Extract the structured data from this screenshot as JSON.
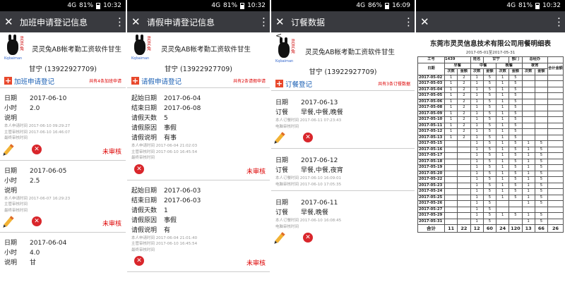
{
  "panels": [
    {
      "status": {
        "signal": "4G",
        "battery": "81%",
        "time": "10:32"
      },
      "title": "加班申请登记信息",
      "app_title": "灵灵兔AB帐考勤工资软件甘生",
      "user": "甘宁 (13922927709)",
      "add_label": "加班申请登记",
      "count": "共有4条加班申请",
      "records": [
        {
          "fields": [
            {
              "k": "日期",
              "v": "2017-06-10"
            },
            {
              "k": "小时",
              "v": "2.0"
            },
            {
              "k": "说明",
              "v": ""
            }
          ],
          "meta": [
            "本人申请时间 2017-06-10 09:29:27",
            "主管审核时间 2017-06-10 16:46:07",
            "最终审核时间"
          ],
          "status": "未审核"
        },
        {
          "fields": [
            {
              "k": "日期",
              "v": "2017-06-05"
            },
            {
              "k": "小时",
              "v": "2.5"
            },
            {
              "k": "说明",
              "v": ""
            }
          ],
          "meta": [
            "本人申请时间 2017-06-07 16:29:23",
            "主管审核时间",
            "最终审核时间"
          ],
          "status": "未审核"
        },
        {
          "fields": [
            {
              "k": "日期",
              "v": "2017-06-04"
            },
            {
              "k": "小时",
              "v": "4.0"
            },
            {
              "k": "说明",
              "v": "甘"
            }
          ],
          "meta": [],
          "status": ""
        }
      ]
    },
    {
      "status": {
        "signal": "4G",
        "battery": "81%",
        "time": "10:32"
      },
      "title": "请假申请登记信息",
      "app_title": "灵灵兔AB帐考勤工资软件甘生",
      "user": "甘宁 (13922927709)",
      "add_label": "请假申请登记",
      "count": "共有2条请假申请",
      "records": [
        {
          "fields": [
            {
              "k": "起始日期",
              "v": "2017-06-04"
            },
            {
              "k": "结束日期",
              "v": "2017-06-08"
            },
            {
              "k": "请假天数",
              "v": "5"
            },
            {
              "k": "请假原因",
              "v": "事假"
            },
            {
              "k": "请假说明",
              "v": "有事"
            }
          ],
          "meta": [
            "本人申请时间 2017-06-04 21:02:03",
            "主管审核时间 2017-06-10 16:45:54",
            "最终审核时间"
          ],
          "status": "未审核"
        },
        {
          "fields": [
            {
              "k": "起始日期",
              "v": "2017-06-03"
            },
            {
              "k": "结束日期",
              "v": "2017-06-03"
            },
            {
              "k": "请假天数",
              "v": "1"
            },
            {
              "k": "请假原因",
              "v": "事假"
            },
            {
              "k": "请假说明",
              "v": "有"
            }
          ],
          "meta": [
            "本人申请时间 2017-06-04 21:01:40",
            "主管审核时间 2017-06-10 16:45:54",
            "最终审核时间"
          ],
          "status": "未审核"
        }
      ]
    },
    {
      "status": {
        "signal": "4G",
        "battery": "86%",
        "time": "16:09"
      },
      "title": "订餐数据",
      "back": "<",
      "app_title": "灵灵兔AB帐考勤工资软件甘生",
      "user": "甘宁 (13922927709)",
      "add_label": "订餐登记",
      "count": "共有3条订餐数据",
      "records": [
        {
          "fields": [
            {
              "k": "日期",
              "v": "2017-06-13"
            },
            {
              "k": "订餐",
              "v": "早餐,中餐,晚餐"
            }
          ],
          "meta": [
            "本人订餐时间 2017-06-11 07:23:43",
            "电脑审核时间"
          ]
        },
        {
          "fields": [
            {
              "k": "日期",
              "v": "2017-06-12"
            },
            {
              "k": "订餐",
              "v": "早餐,中餐,夜宵"
            }
          ],
          "meta": [
            "本人订餐时间 2017-06-10 16:09:01",
            "电脑审核时间 2017-06-10 17:05:35"
          ]
        },
        {
          "fields": [
            {
              "k": "日期",
              "v": "2017-06-11"
            },
            {
              "k": "订餐",
              "v": "早餐,晚餐"
            }
          ],
          "meta": [
            "本人订餐时间 2017-06-10 16:08:45",
            "电脑审核时间"
          ]
        }
      ]
    },
    {
      "status": {
        "signal": "4G",
        "battery": "81%",
        "time": "10:32"
      },
      "report_title": "东莞市灵灵信息技术有限公司用餐明细表",
      "report_sub": "2017-05-01至2017-05-31",
      "info": {
        "emp_no_label": "工号",
        "emp_no": "1439",
        "name_label": "姓名",
        "name": "甘宁",
        "dept_label": "部门",
        "dept": "总经办"
      },
      "meal_headers": [
        "早餐",
        "中餐",
        "晚餐",
        "夜宵"
      ],
      "sub_headers": [
        "次数",
        "金额"
      ],
      "date_label": "日期",
      "total_col": "合计金额",
      "total_label": "合计",
      "rows": [
        [
          "2017-05-02",
          "1",
          "2",
          "1",
          "5",
          "1",
          "5",
          "",
          ""
        ],
        [
          "2017-05-03",
          "1",
          "2",
          "1",
          "5",
          "1",
          "5",
          "",
          ""
        ],
        [
          "2017-05-04",
          "1",
          "2",
          "1",
          "5",
          "1",
          "5",
          "",
          ""
        ],
        [
          "2017-05-05",
          "1",
          "2",
          "1",
          "5",
          "1",
          "5",
          "",
          ""
        ],
        [
          "2017-05-06",
          "1",
          "2",
          "1",
          "5",
          "1",
          "5",
          "",
          ""
        ],
        [
          "2017-05-08",
          "1",
          "2",
          "1",
          "5",
          "1",
          "5",
          "",
          ""
        ],
        [
          "2017-05-09",
          "1",
          "2",
          "1",
          "5",
          "1",
          "5",
          "",
          ""
        ],
        [
          "2017-05-10",
          "1",
          "2",
          "1",
          "5",
          "1",
          "5",
          "",
          ""
        ],
        [
          "2017-05-11",
          "1",
          "2",
          "1",
          "5",
          "1",
          "5",
          "",
          ""
        ],
        [
          "2017-05-12",
          "1",
          "2",
          "1",
          "5",
          "1",
          "5",
          "",
          ""
        ],
        [
          "2017-05-13",
          "1",
          "2",
          "1",
          "5",
          "1",
          "5",
          "",
          ""
        ],
        [
          "2017-05-15",
          "",
          "",
          "1",
          "5",
          "1",
          "5",
          "1",
          "5"
        ],
        [
          "2017-05-16",
          "",
          "",
          "1",
          "5",
          "1",
          "5",
          "1",
          "5"
        ],
        [
          "2017-05-17",
          "",
          "",
          "1",
          "5",
          "1",
          "5",
          "1",
          "5"
        ],
        [
          "2017-05-18",
          "",
          "",
          "1",
          "5",
          "1",
          "5",
          "1",
          "5"
        ],
        [
          "2017-05-19",
          "",
          "",
          "1",
          "5",
          "1",
          "5",
          "1",
          "5"
        ],
        [
          "2017-05-20",
          "",
          "",
          "1",
          "5",
          "1",
          "5",
          "1",
          "5"
        ],
        [
          "2017-05-22",
          "",
          "",
          "1",
          "5",
          "1",
          "5",
          "1",
          "5"
        ],
        [
          "2017-05-23",
          "",
          "",
          "1",
          "5",
          "1",
          "5",
          "1",
          "5"
        ],
        [
          "2017-05-24",
          "",
          "",
          "1",
          "5",
          "1",
          "5",
          "1",
          "5"
        ],
        [
          "2017-05-25",
          "",
          "",
          "1",
          "5",
          "1",
          "5",
          "1",
          "5"
        ],
        [
          "2017-05-26",
          "",
          "",
          "1",
          "5",
          "",
          "",
          "1",
          "5"
        ],
        [
          "2017-05-27",
          "",
          "",
          "1",
          "5",
          "",
          "",
          "",
          ""
        ],
        [
          "2017-05-29",
          "",
          "",
          "1",
          "5",
          "1",
          "5",
          "1",
          "5"
        ],
        [
          "2017-05-31",
          "",
          "",
          "1",
          "5",
          "",
          "",
          "1",
          "5"
        ]
      ],
      "totals": [
        "11",
        "22",
        "12",
        "60",
        "24",
        "120",
        "13",
        "66",
        "26"
      ]
    }
  ]
}
